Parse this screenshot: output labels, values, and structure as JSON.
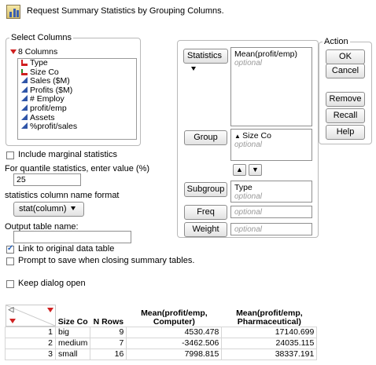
{
  "header": {
    "title": "Request Summary Statistics by Grouping Columns.",
    "icon": "summary-icon"
  },
  "select_columns": {
    "legend": "Select Columns",
    "count_label": "8 Columns",
    "columns": [
      {
        "name": "Type",
        "kind": "nominal"
      },
      {
        "name": "Size Co",
        "kind": "ordinal"
      },
      {
        "name": "Sales ($M)",
        "kind": "continuous"
      },
      {
        "name": "Profits ($M)",
        "kind": "continuous"
      },
      {
        "name": "# Employ",
        "kind": "continuous"
      },
      {
        "name": "profit/emp",
        "kind": "continuous"
      },
      {
        "name": "Assets",
        "kind": "continuous"
      },
      {
        "name": "%profit/sales",
        "kind": "continuous"
      }
    ]
  },
  "options": {
    "include_marginal": {
      "label": "Include marginal statistics",
      "checked": false
    },
    "quantile_label": "For quantile statistics, enter value (%)",
    "quantile_value": "25",
    "name_format_label": "statistics column name format",
    "name_format_value": "stat(column)",
    "output_table_label": "Output table name:",
    "output_table_value": "",
    "link_original": {
      "label": "Link to original data table",
      "checked": true
    },
    "prompt_save": {
      "label": "Prompt to save when closing summary tables.",
      "checked": false
    },
    "keep_open": {
      "label": "Keep dialog open",
      "checked": false
    }
  },
  "roles": {
    "statistics": {
      "button": "Statistics",
      "value": "Mean(profit/emp)",
      "placeholder": "optional"
    },
    "group": {
      "button": "Group",
      "value": "Size Co",
      "placeholder": "optional"
    },
    "subgroup": {
      "button": "Subgroup",
      "value": "Type",
      "placeholder": "optional"
    },
    "freq": {
      "button": "Freq",
      "placeholder": "optional"
    },
    "weight": {
      "button": "Weight",
      "placeholder": "optional"
    }
  },
  "action": {
    "legend": "Action",
    "ok": "OK",
    "cancel": "Cancel",
    "remove": "Remove",
    "recall": "Recall",
    "help": "Help"
  },
  "table": {
    "columns": [
      "Size Co",
      "N Rows",
      "Mean(profit/emp, Computer)",
      "Mean(profit/emp, Pharmaceutical)"
    ],
    "col3_line1": "Mean(profit/emp,",
    "col3_line2": "Computer)",
    "col4_line1": "Mean(profit/emp,",
    "col4_line2": "Pharmaceutical)",
    "rows": [
      {
        "n": "1",
        "size": "big",
        "nrows": "9",
        "computer": "4530.478",
        "pharma": "17140.699"
      },
      {
        "n": "2",
        "size": "medium",
        "nrows": "7",
        "computer": "-3462.506",
        "pharma": "24035.115"
      },
      {
        "n": "3",
        "size": "small",
        "nrows": "16",
        "computer": "7998.815",
        "pharma": "38337.191"
      }
    ]
  }
}
